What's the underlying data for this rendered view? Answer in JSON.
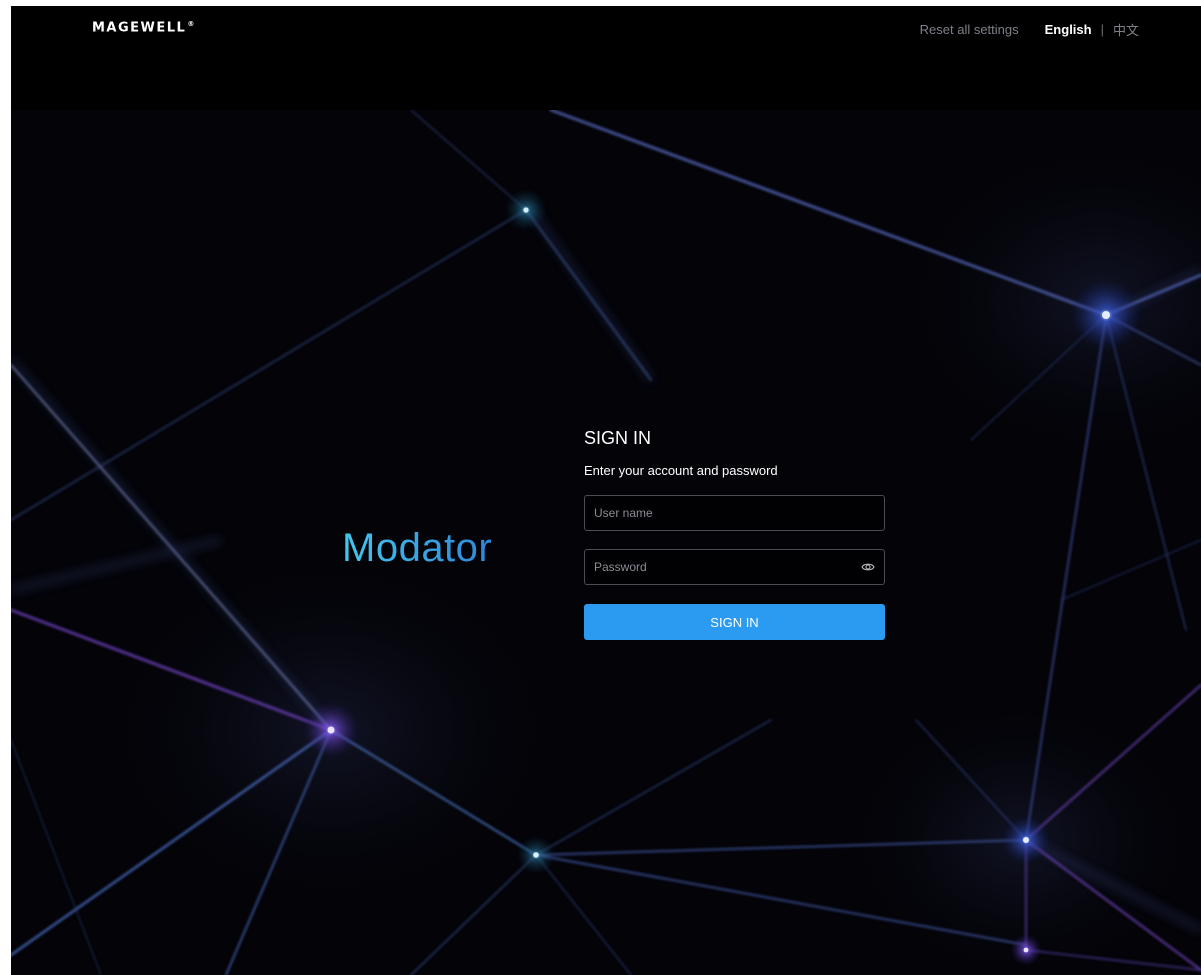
{
  "header": {
    "logo_text": "MAGEWELL",
    "logo_mark": "®",
    "reset_label": "Reset all settings",
    "lang_english": "English",
    "lang_separator": "|",
    "lang_chinese": "中文"
  },
  "brand": {
    "product_name": "Modator"
  },
  "signin": {
    "title": "SIGN IN",
    "subtitle": "Enter your account and password",
    "username_placeholder": "User name",
    "password_placeholder": "Password",
    "button_label": "SIGN IN",
    "eye_icon": "eye-icon"
  },
  "colors": {
    "background": "#000000",
    "accent": "#2a9bf1",
    "brand_gradient_start": "#43c7ee",
    "brand_gradient_end": "#2f86d8",
    "muted_text": "#7d8089"
  }
}
